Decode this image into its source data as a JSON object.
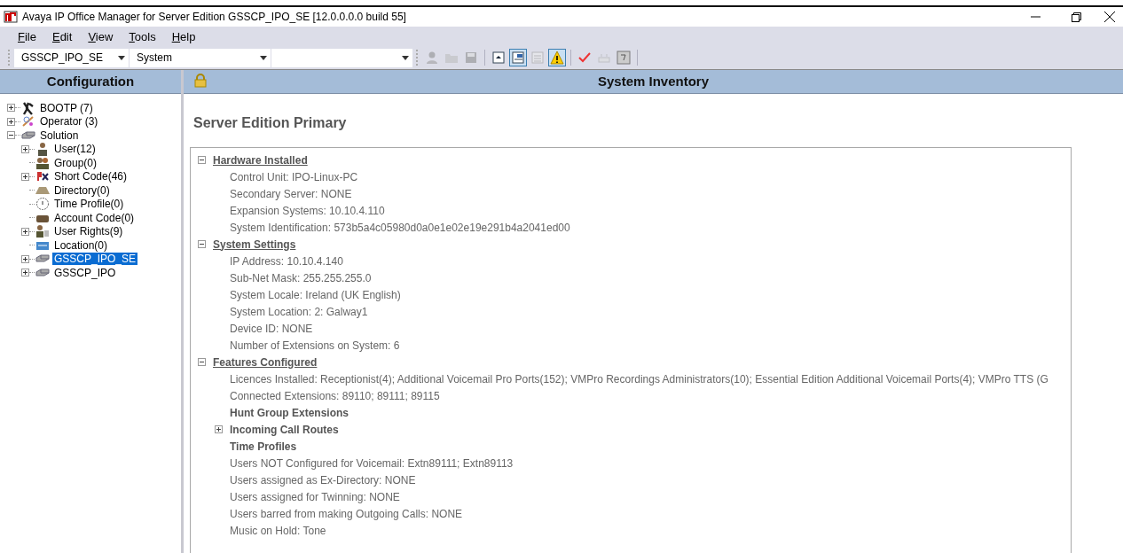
{
  "window": {
    "title": "Avaya IP Office Manager for Server Edition GSSCP_IPO_SE [12.0.0.0.0 build 55]"
  },
  "menu": [
    {
      "label": "File"
    },
    {
      "label": "Edit"
    },
    {
      "label": "View"
    },
    {
      "label": "Tools"
    },
    {
      "label": "Help"
    }
  ],
  "toolbar": {
    "combos": [
      {
        "value": "GSSCP_IPO_SE"
      },
      {
        "value": "System"
      }
    ],
    "buttons": [
      {
        "kind": "person",
        "disabled": true,
        "pressed": false
      },
      {
        "kind": "folder",
        "disabled": true,
        "pressed": false
      },
      {
        "kind": "save",
        "disabled": true,
        "pressed": false
      },
      {
        "kind": "sep"
      },
      {
        "kind": "panel-up",
        "disabled": false,
        "pressed": false
      },
      {
        "kind": "panel-right",
        "disabled": false,
        "pressed": true
      },
      {
        "kind": "panel-list",
        "disabled": true,
        "pressed": false
      },
      {
        "kind": "warning",
        "disabled": false,
        "pressed": true
      },
      {
        "kind": "sep"
      },
      {
        "kind": "check",
        "disabled": false,
        "pressed": false
      },
      {
        "kind": "tray",
        "disabled": true,
        "pressed": false
      },
      {
        "kind": "help",
        "disabled": false,
        "pressed": false
      }
    ]
  },
  "sidebar": {
    "title": "Configuration",
    "items": [
      {
        "label": "BOOTP (7)",
        "kind": "bootp",
        "expanded": false,
        "selected": false
      },
      {
        "label": "Operator (3)",
        "kind": "operator",
        "expanded": false,
        "selected": false
      },
      {
        "label": "Solution",
        "kind": "server",
        "expanded": true,
        "selected": false,
        "children": [
          {
            "label": "User(12)",
            "kind": "user",
            "expanded": false,
            "selected": false
          },
          {
            "label": "Group(0)",
            "kind": "group",
            "selected": false
          },
          {
            "label": "Short Code(46)",
            "kind": "shortcode",
            "expanded": false,
            "selected": false
          },
          {
            "label": "Directory(0)",
            "kind": "directory",
            "selected": false
          },
          {
            "label": "Time Profile(0)",
            "kind": "clock",
            "selected": false
          },
          {
            "label": "Account Code(0)",
            "kind": "account",
            "selected": false
          },
          {
            "label": "User Rights(9)",
            "kind": "rights",
            "expanded": false,
            "selected": false
          },
          {
            "label": "Location(0)",
            "kind": "location",
            "selected": false
          },
          {
            "label": "GSSCP_IPO_SE",
            "kind": "server",
            "expanded": false,
            "selected": true
          },
          {
            "label": "GSSCP_IPO",
            "kind": "server",
            "expanded": false,
            "selected": false
          }
        ]
      }
    ]
  },
  "main": {
    "title": "System Inventory",
    "subtitle": "Server Edition Primary",
    "sections": [
      {
        "heading": "Hardware Installed",
        "expanded": true,
        "items": [
          {
            "kind": "line",
            "text": "Control Unit: IPO-Linux-PC"
          },
          {
            "kind": "line",
            "text": "Secondary Server: NONE"
          },
          {
            "kind": "line",
            "text": "Expansion Systems: 10.10.4.110"
          },
          {
            "kind": "line",
            "text": "System Identification: 573b5a4c05980d0a0e1e02e19e291b4a2041ed00"
          }
        ]
      },
      {
        "heading": "System Settings",
        "expanded": true,
        "items": [
          {
            "kind": "line",
            "text": "IP Address: 10.10.4.140"
          },
          {
            "kind": "line",
            "text": "Sub-Net Mask: 255.255.255.0"
          },
          {
            "kind": "line",
            "text": "System Locale: Ireland (UK English)"
          },
          {
            "kind": "line",
            "text": "System Location: 2: Galway1"
          },
          {
            "kind": "line",
            "text": "Device ID: NONE"
          },
          {
            "kind": "line",
            "text": "Number of Extensions on System: 6"
          }
        ]
      },
      {
        "heading": "Features Configured",
        "expanded": true,
        "items": [
          {
            "kind": "line",
            "text": "Licences Installed: Receptionist(4); Additional Voicemail Pro Ports(152); VMPro Recordings Administrators(10); Essential Edition Additional Voicemail Ports(4); VMPro TTS (G"
          },
          {
            "kind": "line",
            "text": "Connected Extensions: 89110; 89111; 89115"
          },
          {
            "kind": "group",
            "text": "Hunt Group Extensions"
          },
          {
            "kind": "collapsed",
            "text": "Incoming Call Routes"
          },
          {
            "kind": "group",
            "text": "Time Profiles"
          },
          {
            "kind": "line",
            "text": "Users NOT Configured for Voicemail: Extn89111; Extn89113"
          },
          {
            "kind": "line",
            "text": "Users assigned as Ex-Directory: NONE"
          },
          {
            "kind": "line",
            "text": "Users assigned for Twinning: NONE"
          },
          {
            "kind": "line",
            "text": "Users barred from making Outgoing Calls: NONE"
          },
          {
            "kind": "line",
            "text": "Music on Hold: Tone"
          }
        ]
      }
    ]
  }
}
